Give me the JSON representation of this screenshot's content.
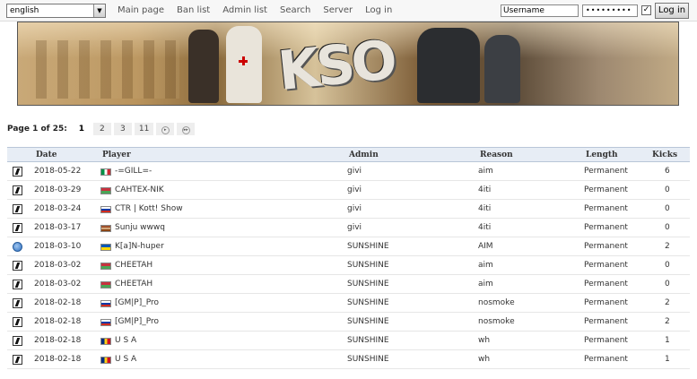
{
  "topbar": {
    "language": "english",
    "nav": [
      "Main page",
      "Ban list",
      "Admin list",
      "Search",
      "Server",
      "Log in"
    ],
    "username_value": "Username",
    "password_value": "•••••••••",
    "remember_check": "✓",
    "login_button": "Log in"
  },
  "banner": {
    "logo_text": "KSO"
  },
  "pager": {
    "label": "Page 1 of 25:",
    "pages": [
      "1",
      "2",
      "3",
      "11"
    ],
    "current": "1",
    "next_icon": "▸",
    "last_icon": "▸▸"
  },
  "table": {
    "headers": [
      "Date",
      "Player",
      "Admin",
      "Reason",
      "Length",
      "Kicks"
    ],
    "rows": [
      {
        "game": "cs",
        "date": "2018-05-22",
        "flag": "it",
        "player": "-=GILL=-",
        "admin": "givi",
        "reason": "aim",
        "length": "Permanent",
        "kicks": "6"
      },
      {
        "game": "cs",
        "date": "2018-03-29",
        "flag": "by",
        "player": "CAHTEX-NIK",
        "admin": "givi",
        "reason": "4iti",
        "length": "Permanent",
        "kicks": "0"
      },
      {
        "game": "cs",
        "date": "2018-03-24",
        "flag": "ru",
        "player": "CTR | Kott! Show",
        "admin": "givi",
        "reason": "4iti",
        "length": "Permanent",
        "kicks": "0"
      },
      {
        "game": "cs",
        "date": "2018-03-17",
        "flag": "in",
        "player": "Sunju wwwq",
        "admin": "givi",
        "reason": "4iti",
        "length": "Permanent",
        "kicks": "0"
      },
      {
        "game": "hl",
        "date": "2018-03-10",
        "flag": "ua",
        "player": "K[a]N-huper",
        "admin": "SUNSHINE",
        "reason": "AIM",
        "length": "Permanent",
        "kicks": "2"
      },
      {
        "game": "cs",
        "date": "2018-03-02",
        "flag": "by",
        "player": "CHEETAH",
        "admin": "SUNSHINE",
        "reason": "aim",
        "length": "Permanent",
        "kicks": "0"
      },
      {
        "game": "cs",
        "date": "2018-03-02",
        "flag": "by",
        "player": "CHEETAH",
        "admin": "SUNSHINE",
        "reason": "aim",
        "length": "Permanent",
        "kicks": "0"
      },
      {
        "game": "cs",
        "date": "2018-02-18",
        "flag": "ru",
        "player": "[GM|P]_Pro",
        "admin": "SUNSHINE",
        "reason": "nosmoke",
        "length": "Permanent",
        "kicks": "2"
      },
      {
        "game": "cs",
        "date": "2018-02-18",
        "flag": "ru",
        "player": "[GM|P]_Pro",
        "admin": "SUNSHINE",
        "reason": "nosmoke",
        "length": "Permanent",
        "kicks": "2"
      },
      {
        "game": "cs",
        "date": "2018-02-18",
        "flag": "ro",
        "player": "U S A",
        "admin": "SUNSHINE",
        "reason": "wh",
        "length": "Permanent",
        "kicks": "1"
      },
      {
        "game": "cs",
        "date": "2018-02-18",
        "flag": "ro",
        "player": "U S A",
        "admin": "SUNSHINE",
        "reason": "wh",
        "length": "Permanent",
        "kicks": "1"
      }
    ]
  },
  "flag_colors": {
    "it": [
      "#009246",
      "#ffffff",
      "#ce2b37"
    ],
    "by": [
      "#c8313e",
      "#4aa657"
    ],
    "ru": [
      "#ffffff",
      "#0039a6",
      "#d52b1e"
    ],
    "in": [
      "#a0522d",
      "#d2a679",
      "#8b4513"
    ],
    "ua": [
      "#0057b7",
      "#ffd700"
    ],
    "ro": [
      "#002b7f",
      "#fcd116",
      "#ce1126"
    ]
  }
}
